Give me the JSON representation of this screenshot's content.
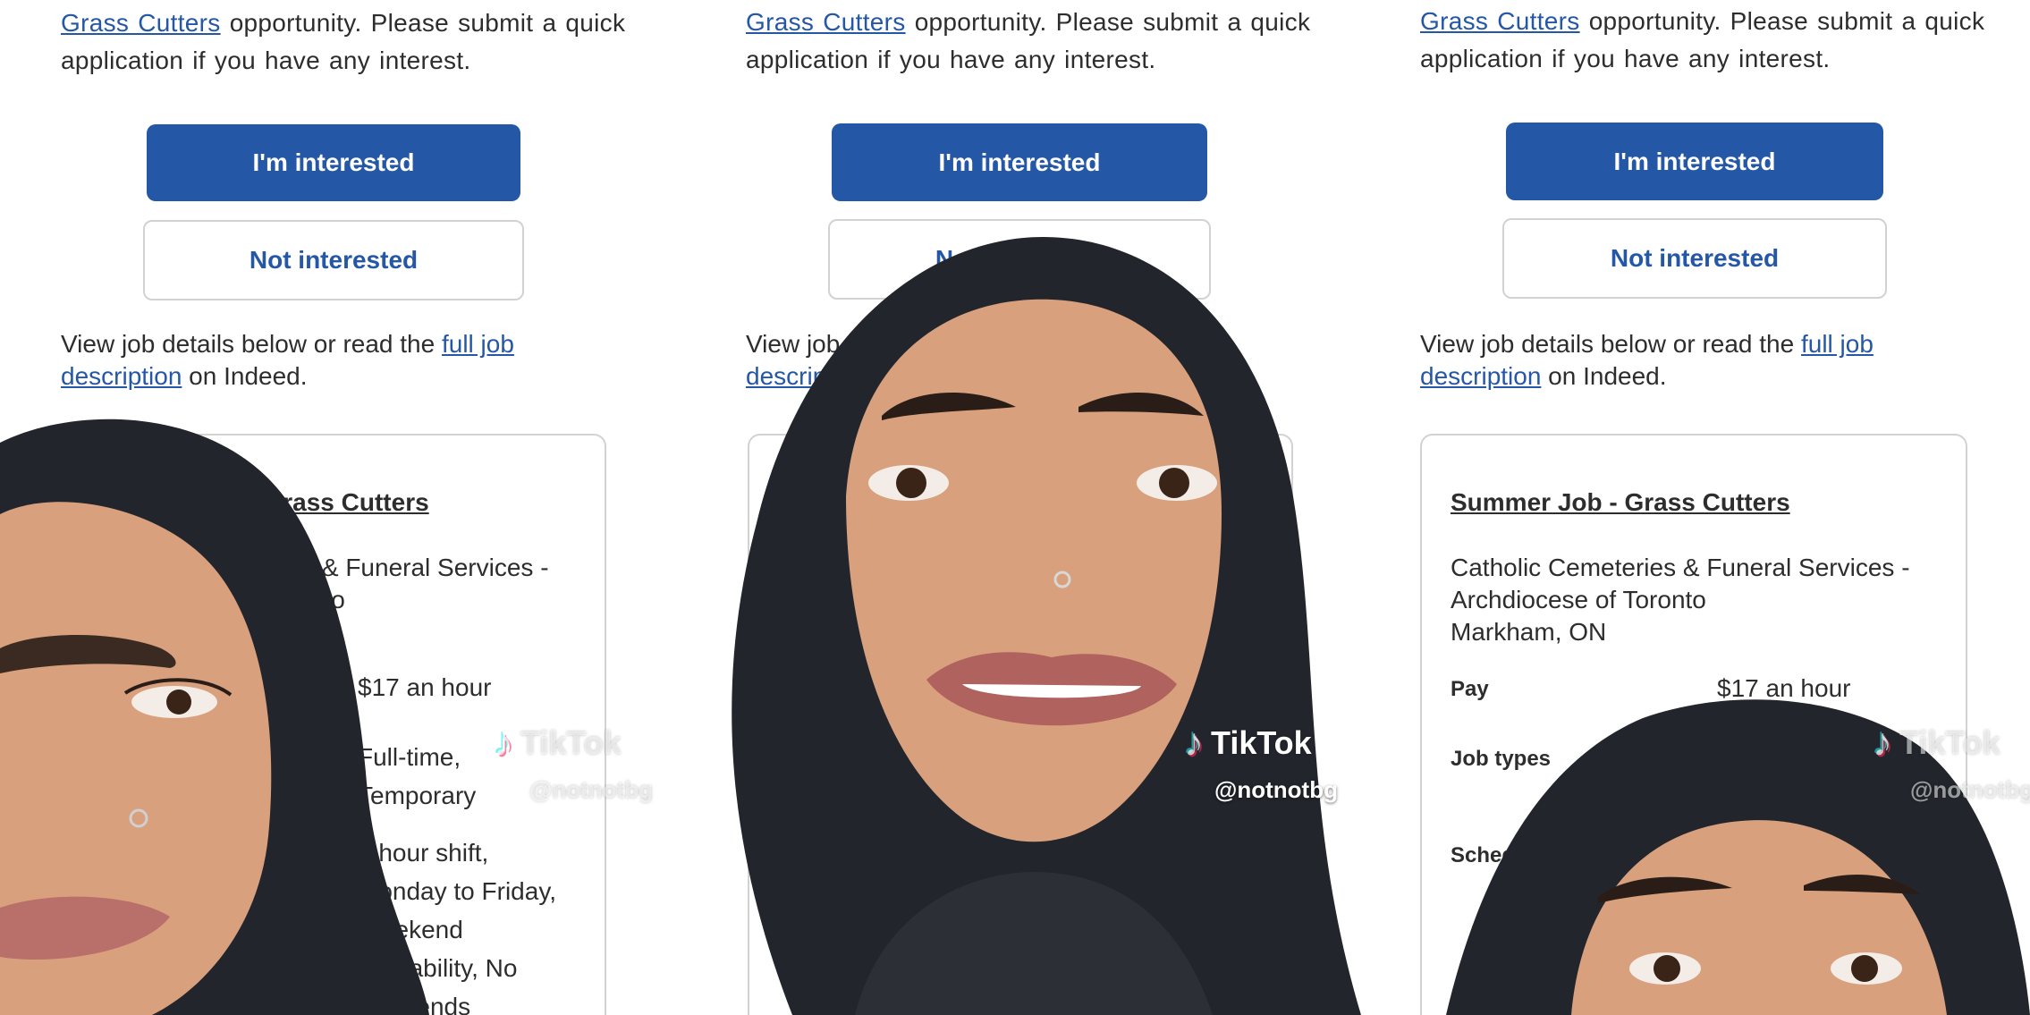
{
  "email": {
    "intro_link": "Grass Cutters",
    "intro_text_line1": " opportunity. Please submit a quick",
    "intro_text_line2": "application if you have any interest.",
    "interested_button": "I'm interested",
    "not_interested_button": "Not interested",
    "view_prefix": "View job details below or read the ",
    "view_link_part1": "full job",
    "view_link_part2": "description",
    "view_suffix": " on Indeed."
  },
  "job": {
    "title": "Summer Job - Grass Cutters",
    "company_line1": "Catholic Cemeteries & Funeral Services -",
    "company_line2": "Archdiocese of Toronto",
    "location": "Markham, ON",
    "pay_label": "Pay",
    "pay_value": "$17 an hour",
    "job_types_label": "Job types",
    "job_types_value_line1": "Full-time,",
    "job_types_value_line2": "Temporary",
    "schedule_label": "Schedule",
    "schedule_value_line1": "8 hour shift,",
    "schedule_value_line2": "Monday to Friday,",
    "schedule_value_line3": "Weekend",
    "schedule_value_line4": "availability, No",
    "schedule_value_line5": "weekends"
  },
  "watermark": {
    "brand": "TikTok",
    "handle": "@notnotbg",
    "note_glyph": "♪"
  },
  "colors": {
    "accent": "#2557a7",
    "text": "#2d2d2d",
    "border": "#d4d2d0",
    "hair": "#22262c",
    "skin": "#d9a07e"
  }
}
